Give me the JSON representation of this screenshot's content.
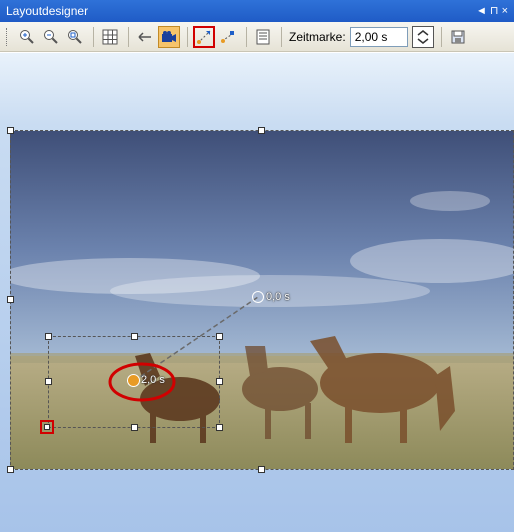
{
  "window": {
    "title": "Layoutdesigner",
    "pin_label": "◄ ⊓ ×"
  },
  "toolbar": {
    "buttons": [
      {
        "name": "zoom-in-icon"
      },
      {
        "name": "zoom-out-icon"
      },
      {
        "name": "zoom-fit-icon"
      },
      {
        "name": "grid-icon"
      },
      {
        "name": "camera-path-icon"
      },
      {
        "name": "camera-icon",
        "state": "active"
      },
      {
        "name": "motion-path-icon",
        "state": "highlighted"
      },
      {
        "name": "motion-path-2-icon"
      },
      {
        "name": "properties-icon"
      }
    ],
    "zeitmarke_label": "Zeitmarke:",
    "zeitmarke_value": "2,00 s",
    "save_icon": "save-icon"
  },
  "canvas": {
    "keyframe_start_label": "0,0 s",
    "keyframe_current_label": "2,0 s"
  },
  "colors": {
    "accent": "#d10000",
    "active": "#f6c46b",
    "titlebar": "#2f72d8"
  }
}
